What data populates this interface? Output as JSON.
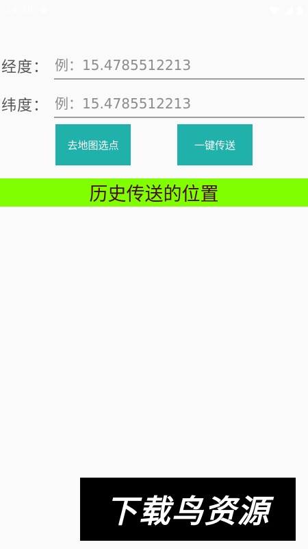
{
  "status_bar": {
    "time": "14:38",
    "icons": [
      "settings-gear-icon",
      "wifi-icon",
      "signal-icon",
      "battery-icon"
    ]
  },
  "form": {
    "longitude_label": "经度：",
    "longitude_placeholder": "例：15.4785512213",
    "longitude_value": "",
    "latitude_label": "纬度：",
    "latitude_placeholder": "例：15.4785512213",
    "latitude_value": ""
  },
  "buttons": {
    "pick_on_map": "去地图选点",
    "one_click_send": "一键传送"
  },
  "history": {
    "title": "历史传送的位置",
    "items": []
  },
  "watermark": {
    "text": "下载鸟资源"
  },
  "colors": {
    "button": "#20b2aa",
    "banner": "#7fff00",
    "banner_text": "#4a0e0e",
    "background": "#fafafa"
  }
}
